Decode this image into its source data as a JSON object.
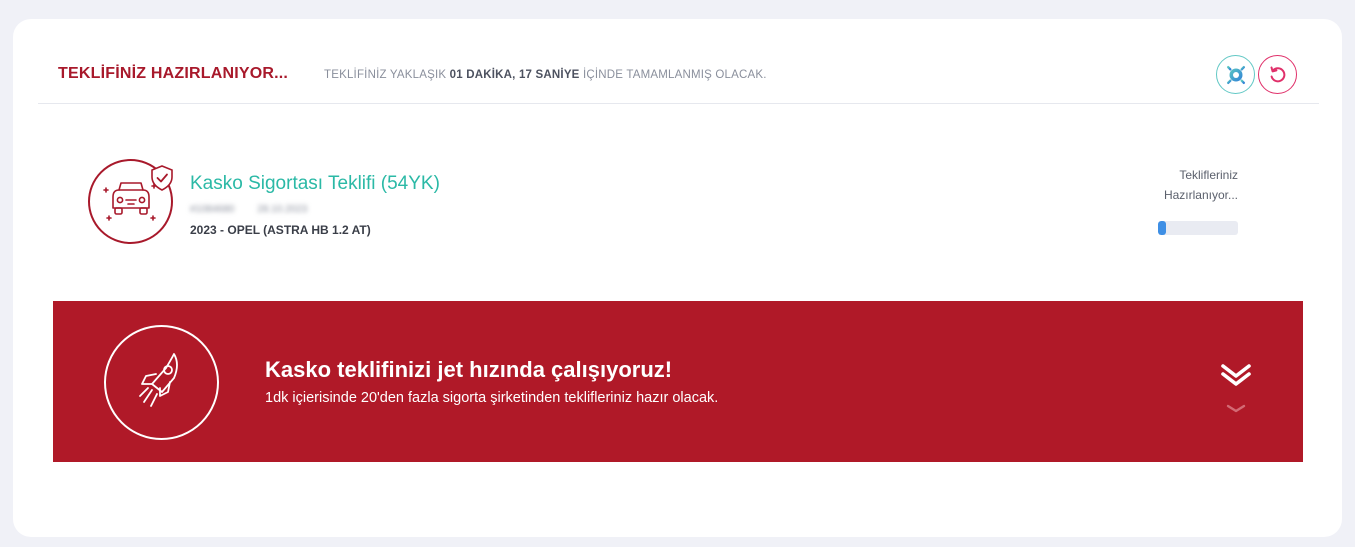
{
  "header": {
    "title": "TEKLİFİNİZ HAZIRLANIYOR...",
    "subtitle_prefix": "TEKLİFİNİZ YAKLAŞIK",
    "subtitle_time": "01 DAKİKA, 17 SANİYE",
    "subtitle_suffix": "İÇİNDE TAMAMLANMIŞ OLACAK.",
    "loader_icon": "gear-spinner-icon",
    "refresh_icon": "refresh-icon"
  },
  "offer": {
    "title": "Kasko Sigortası Teklifi (54YK)",
    "blurred_ref": "#1084680",
    "blurred_date": "28.10.2023",
    "vehicle": "2023 - OPEL (ASTRA HB 1.2 AT)",
    "status_line1": "Teklifleriniz",
    "status_line2": "Hazırlanıyor...",
    "progress": 0.1,
    "icon": "car-icon"
  },
  "banner": {
    "title": "Kasko teklifinizi jet hızında çalışıyoruz!",
    "description": "1dk içierisinde 20'den fazla sigorta şirketinden teklifleriniz hazır olacak.",
    "icon": "rocket-icon",
    "color": "#b01928"
  },
  "colors": {
    "brand_red": "#a8192b",
    "accent_teal": "#2bb9a6",
    "progress_blue": "#3e8fe5"
  }
}
